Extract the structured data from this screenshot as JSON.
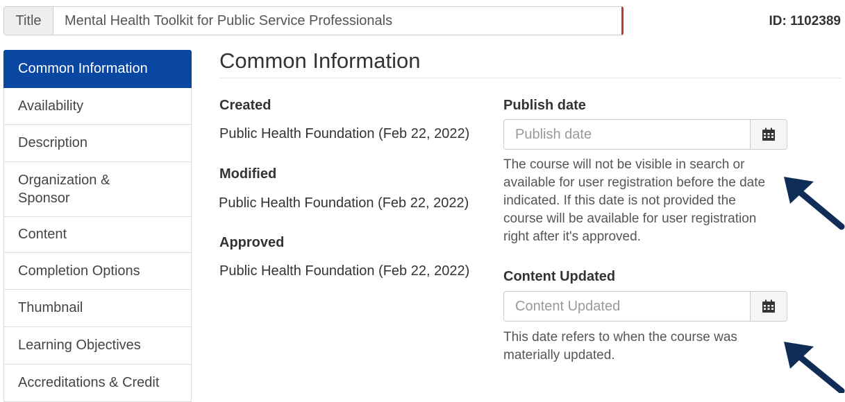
{
  "title_bar": {
    "label": "Title",
    "value": "Mental Health Toolkit for Public Service Professionals",
    "course_id": "ID: 1102389"
  },
  "sidebar": {
    "items": [
      {
        "label": "Common Information",
        "active": true
      },
      {
        "label": "Availability"
      },
      {
        "label": "Description"
      },
      {
        "label": "Organization & Sponsor"
      },
      {
        "label": "Content"
      },
      {
        "label": "Completion Options"
      },
      {
        "label": "Thumbnail"
      },
      {
        "label": "Learning Objectives"
      },
      {
        "label": "Accreditations & Credit"
      }
    ]
  },
  "main": {
    "heading": "Common Information",
    "created": {
      "label": "Created",
      "value": "Public Health Foundation (Feb 22, 2022)"
    },
    "modified": {
      "label": "Modified",
      "value": "Public Health Foundation (Feb 22, 2022)"
    },
    "approved": {
      "label": "Approved",
      "value": "Public Health Foundation (Feb 22, 2022)"
    },
    "publish_date": {
      "label": "Publish date",
      "placeholder": "Publish date",
      "help": "The course will not be visible in search or available for user registration before the date indicated. If this date is not provided the course will be available for user registration right after it's approved."
    },
    "content_updated": {
      "label": "Content Updated",
      "placeholder": "Content Updated",
      "help": "This date refers to when the course was materially updated."
    }
  },
  "colors": {
    "active_nav": "#0a47a3",
    "title_accent": "#c0392b",
    "arrow": "#0f2d57"
  },
  "icons": {
    "calendar": "calendar-icon",
    "arrow": "arrow-pointer-icon"
  }
}
